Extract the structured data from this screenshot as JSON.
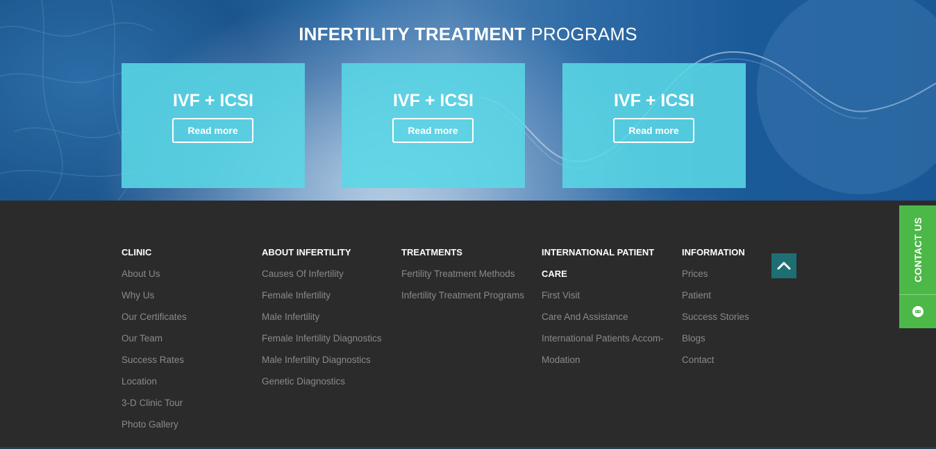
{
  "hero": {
    "title_bold": "INFERTILITY TREATMENT",
    "title_light": "PROGRAMS",
    "cards": [
      {
        "title": "IVF + ICSI",
        "button": "Read more"
      },
      {
        "title": "IVF + ICSI",
        "button": "Read more"
      },
      {
        "title": "IVF + ICSI",
        "button": "Read more"
      }
    ]
  },
  "footer": {
    "columns": [
      {
        "heading": "CLINIC",
        "links": [
          "About Us",
          "Why Us",
          "Our Certificates",
          "Our Team",
          "Success Rates",
          "Location",
          "3-D Clinic Tour",
          "Photo Gallery"
        ]
      },
      {
        "heading": "ABOUT INFERTILITY",
        "links": [
          "Causes Of Infertility",
          "Female Infertility",
          "Male Infertility",
          "Female Infertility Diagnostics",
          "Male Infertility Diagnostics",
          "Genetic Diagnostics"
        ]
      },
      {
        "heading": "TREATMENTS",
        "links": [
          "Fertility Treatment Methods",
          "Infertility Treatment Programs"
        ]
      },
      {
        "heading_line1": "INTERNATIONAL PATIENT",
        "heading_line2": "CARE",
        "links": [
          "First Visit",
          "Care And Assistance",
          "International Patients Accom-",
          "Modation"
        ]
      },
      {
        "heading": "INFORMATION",
        "links": [
          "Prices",
          "Patient",
          "Success Stories",
          "Blogs",
          "Contact"
        ]
      }
    ]
  },
  "contact_tab": {
    "label": "CONTACT US",
    "icon": "chat-icon"
  },
  "scroll_top": {
    "icon": "chevron-up-icon"
  },
  "colors": {
    "card": "#5ad7e6",
    "footer": "#2b2b2b",
    "contact": "#4cb848",
    "scroll_top": "#1e6f73"
  }
}
